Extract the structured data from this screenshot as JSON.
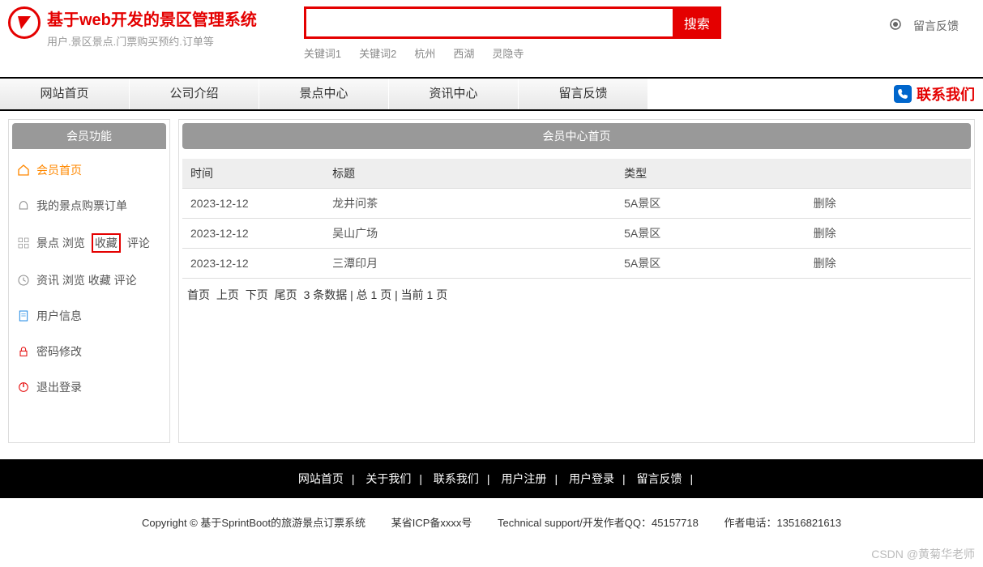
{
  "header": {
    "titleMain": "基于web开发的景区管理系统",
    "titleSub": "用户.景区景点.门票购买预约.订单等",
    "searchPlaceholder": "",
    "searchBtn": "搜索",
    "keywords": [
      "关键词1",
      "关键词2",
      "杭州",
      "西湖",
      "灵隐寺"
    ],
    "feedback": "留言反馈"
  },
  "nav": {
    "items": [
      "网站首页",
      "公司介绍",
      "景点中心",
      "资讯中心",
      "留言反馈"
    ],
    "contact": "联系我们"
  },
  "sidebar": {
    "head": "会员功能",
    "items": [
      {
        "label": "会员首页",
        "icon": "home-icon",
        "active": true
      },
      {
        "label": "我的景点购票订单",
        "icon": "ticket-icon"
      },
      {
        "label_parts": [
          "景点 浏览",
          "收藏",
          "评论"
        ],
        "icon": "grid-icon",
        "highlight": true
      },
      {
        "label": "资讯 浏览 收藏 评论",
        "icon": "clock-icon"
      },
      {
        "label": "用户信息",
        "icon": "doc-icon"
      },
      {
        "label": "密码修改",
        "icon": "lock-icon"
      },
      {
        "label": "退出登录",
        "icon": "power-icon"
      }
    ]
  },
  "content": {
    "head": "会员中心首页",
    "columns": [
      "时间",
      "标题",
      "类型",
      ""
    ],
    "rows": [
      {
        "time": "2023-12-12",
        "title": "龙井问茶",
        "type": "5A景区",
        "action": "删除"
      },
      {
        "time": "2023-12-12",
        "title": "吴山广场",
        "type": "5A景区",
        "action": "删除"
      },
      {
        "time": "2023-12-12",
        "title": "三潭印月",
        "type": "5A景区",
        "action": "删除"
      }
    ],
    "pager": {
      "first": "首页",
      "prev": "上页",
      "next": "下页",
      "last": "尾页",
      "info": "3 条数据 | 总 1 页 | 当前 1 页"
    }
  },
  "footer": {
    "links": [
      "网站首页",
      "关于我们",
      "联系我们",
      "用户注册",
      "用户登录",
      "留言反馈"
    ],
    "copyright": "Copyright © 基于SprintBoot的旅游景点订票系统",
    "icp": "某省ICP备xxxx号",
    "tech": "Technical support/开发作者QQ：45157718",
    "author": "作者电话：13516821613"
  },
  "watermark": "CSDN @黄菊华老师"
}
